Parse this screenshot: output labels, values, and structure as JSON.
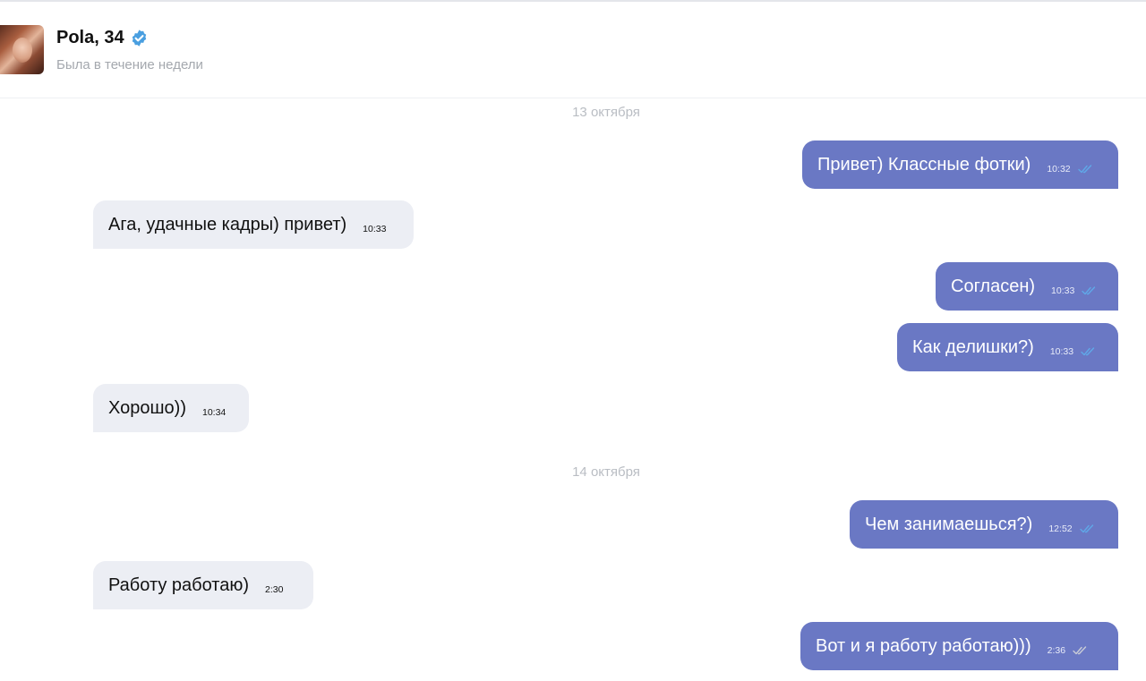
{
  "header": {
    "name": "Pola, 34",
    "status": "Была в течение недели"
  },
  "colors": {
    "outgoing_bubble": "#6a78c4",
    "incoming_bubble": "#eceef4",
    "read_tick": "#5fa8e8",
    "sent_tick": "#c9ccd6",
    "verified_badge": "#4a9fe0"
  },
  "messages": {
    "date1": "13 октября",
    "m1": {
      "text": "Привет) Классные фотки)",
      "time": "10:32",
      "status": "read-ticks-icon"
    },
    "m2": {
      "text": "Ага, удачные кадры) привет)",
      "time": "10:33"
    },
    "m3": {
      "text": "Согласен)",
      "time": "10:33",
      "status": "read-ticks-icon"
    },
    "m4": {
      "text": "Как делишки?)",
      "time": "10:33",
      "status": "read-ticks-icon"
    },
    "m5": {
      "text": "Хорошо))",
      "time": "10:34"
    },
    "date2": "14 октября",
    "m6": {
      "text": "Чем занимаешься?)",
      "time": "12:52",
      "status": "read-ticks-icon"
    },
    "m7": {
      "text": "Работу работаю)",
      "time": "2:30"
    },
    "m8": {
      "text": "Вот и я работу работаю)))",
      "time": "2:36",
      "status": "sent-ticks-icon"
    }
  }
}
